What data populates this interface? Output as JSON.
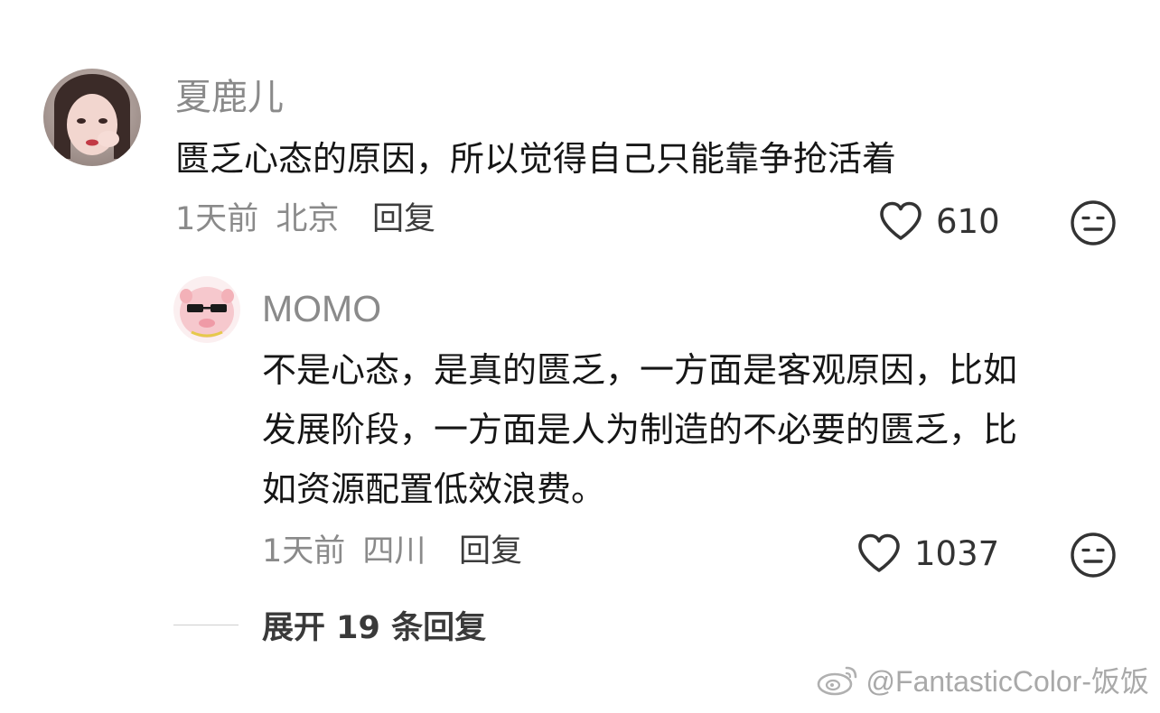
{
  "comments": [
    {
      "username": "夏鹿儿",
      "content_lines": [
        "匮乏心态的原因，所以觉得自己只能靠争抢活着"
      ],
      "time": "1天前",
      "location": "北京",
      "reply_label": "回复",
      "like_count": "610"
    },
    {
      "username": "MOMO",
      "content_lines": [
        "不是心态，是真的匮乏，一方面是客观原因，比如",
        "发展阶段，一方面是人为制造的不必要的匮乏，比",
        "如资源配置低效浪费。"
      ],
      "time": "1天前",
      "location": "四川",
      "reply_label": "回复",
      "like_count": "1037"
    }
  ],
  "expand_replies_label": "展开 19 条回复",
  "watermark": "@FantasticColor-饭饭",
  "icons": {
    "like": "heart-outline-icon",
    "dislike": "meh-face-icon",
    "watermark": "weibo-logo-icon"
  },
  "colors": {
    "text_primary": "#161616",
    "text_secondary": "#8a8a8a",
    "icon": "#333333"
  }
}
